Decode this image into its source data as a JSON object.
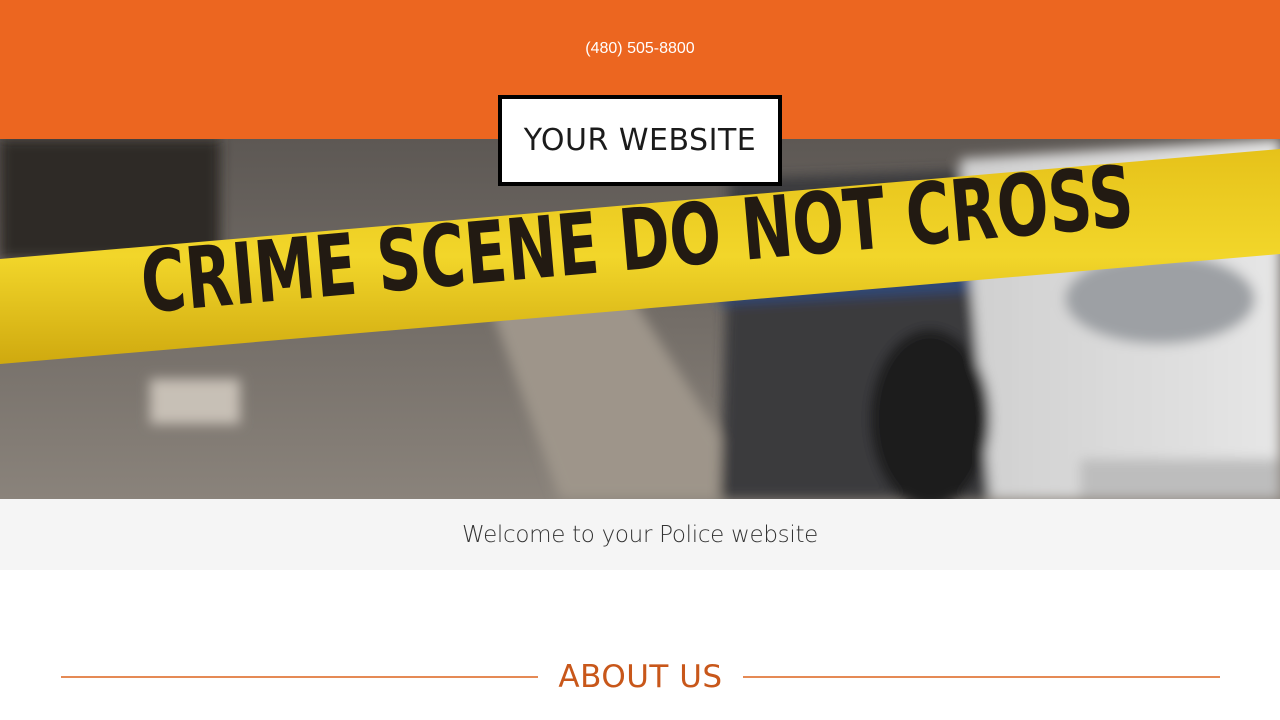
{
  "header": {
    "phone": "(480) 505-8800",
    "background_color": "#ec6620",
    "logo_text": "YOUR WEBSITE"
  },
  "hero": {
    "image": "crime-scene-tape-photo",
    "tape_text": "CRIME SCENE DO NOT CROSS"
  },
  "welcome": {
    "text": "Welcome to your Police website"
  },
  "about": {
    "title": "ABOUT US",
    "accent_color": "#c8571a"
  }
}
